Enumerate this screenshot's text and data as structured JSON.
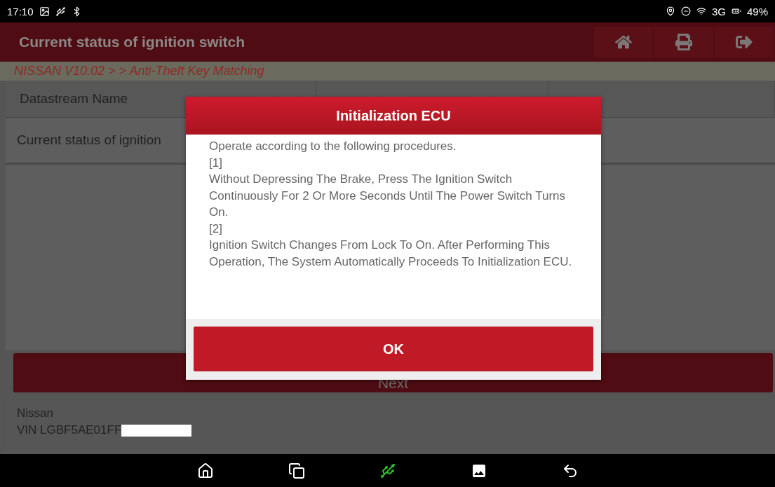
{
  "status_bar": {
    "time": "17:10",
    "network": "3G",
    "battery": "49%"
  },
  "header": {
    "title": "Current status of ignition switch"
  },
  "breadcrumb": "NISSAN V10.02 >  > Anti-Theft Key Matching",
  "table": {
    "columns": [
      "Datastream Name"
    ],
    "rows": [
      [
        "Current status of ignition"
      ]
    ]
  },
  "next_button": "Next",
  "footer": {
    "make": "Nissan",
    "vin": "VIN LGBF5AE01FF"
  },
  "dialog": {
    "title": "Initialization ECU",
    "lines": [
      "Operate according to the following procedures.",
      "[1]",
      "Without Depressing The Brake, Press The Ignition Switch Continuously For 2 Or More Seconds Until The Power Switch Turns On.",
      "[2]",
      "Ignition Switch Changes From Lock To On. After Performing This Operation, The System Automatically Proceeds To Initialization ECU."
    ],
    "ok": "OK"
  }
}
